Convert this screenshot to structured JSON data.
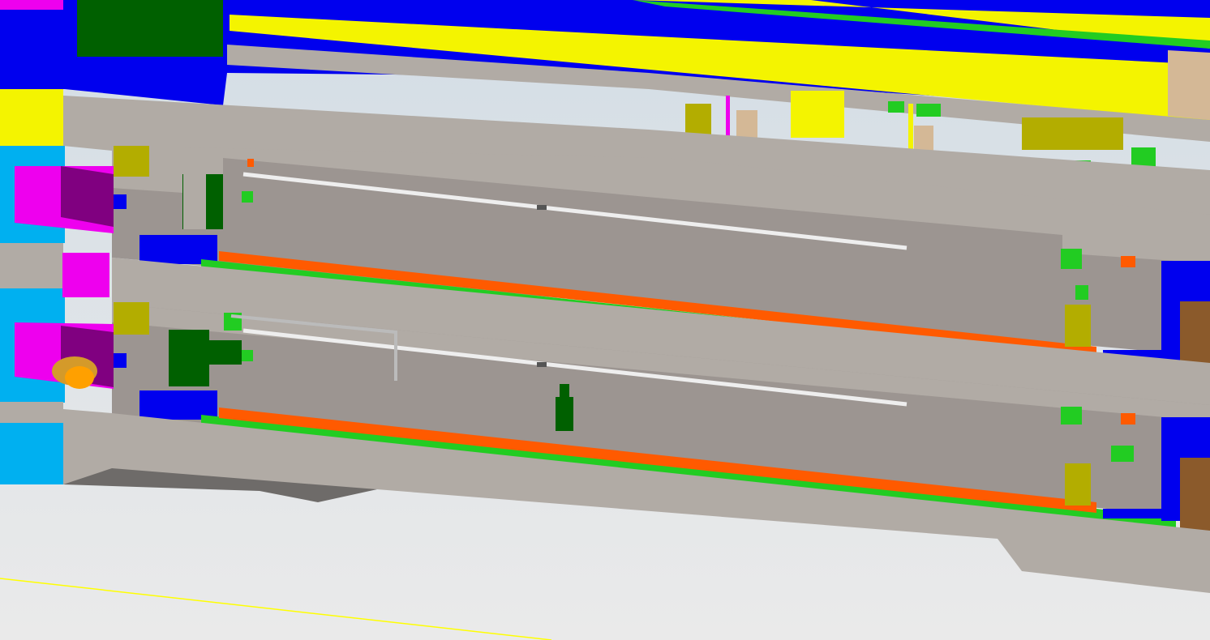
{
  "viewport": {
    "background_top": "#d3dde5",
    "background_bottom": "#eaeaea"
  },
  "palette": {
    "hull": "#b1aba5",
    "hull_dark": "#9c9591",
    "floor_shadow": "#6e6b69",
    "blue": "#0000ee",
    "cyan": "#00b0f0",
    "yellow": "#f4f400",
    "olive": "#b3ad00",
    "green": "#22cc22",
    "dark_green": "#006000",
    "orange": "#ff5a00",
    "magenta": "#ee00ee",
    "purple": "#800080",
    "tan": "#d4b896",
    "brown": "#8b5a2b",
    "gold": "#d49a2a",
    "pipe": "#eeeeee",
    "guide_line": "#ffff00"
  }
}
